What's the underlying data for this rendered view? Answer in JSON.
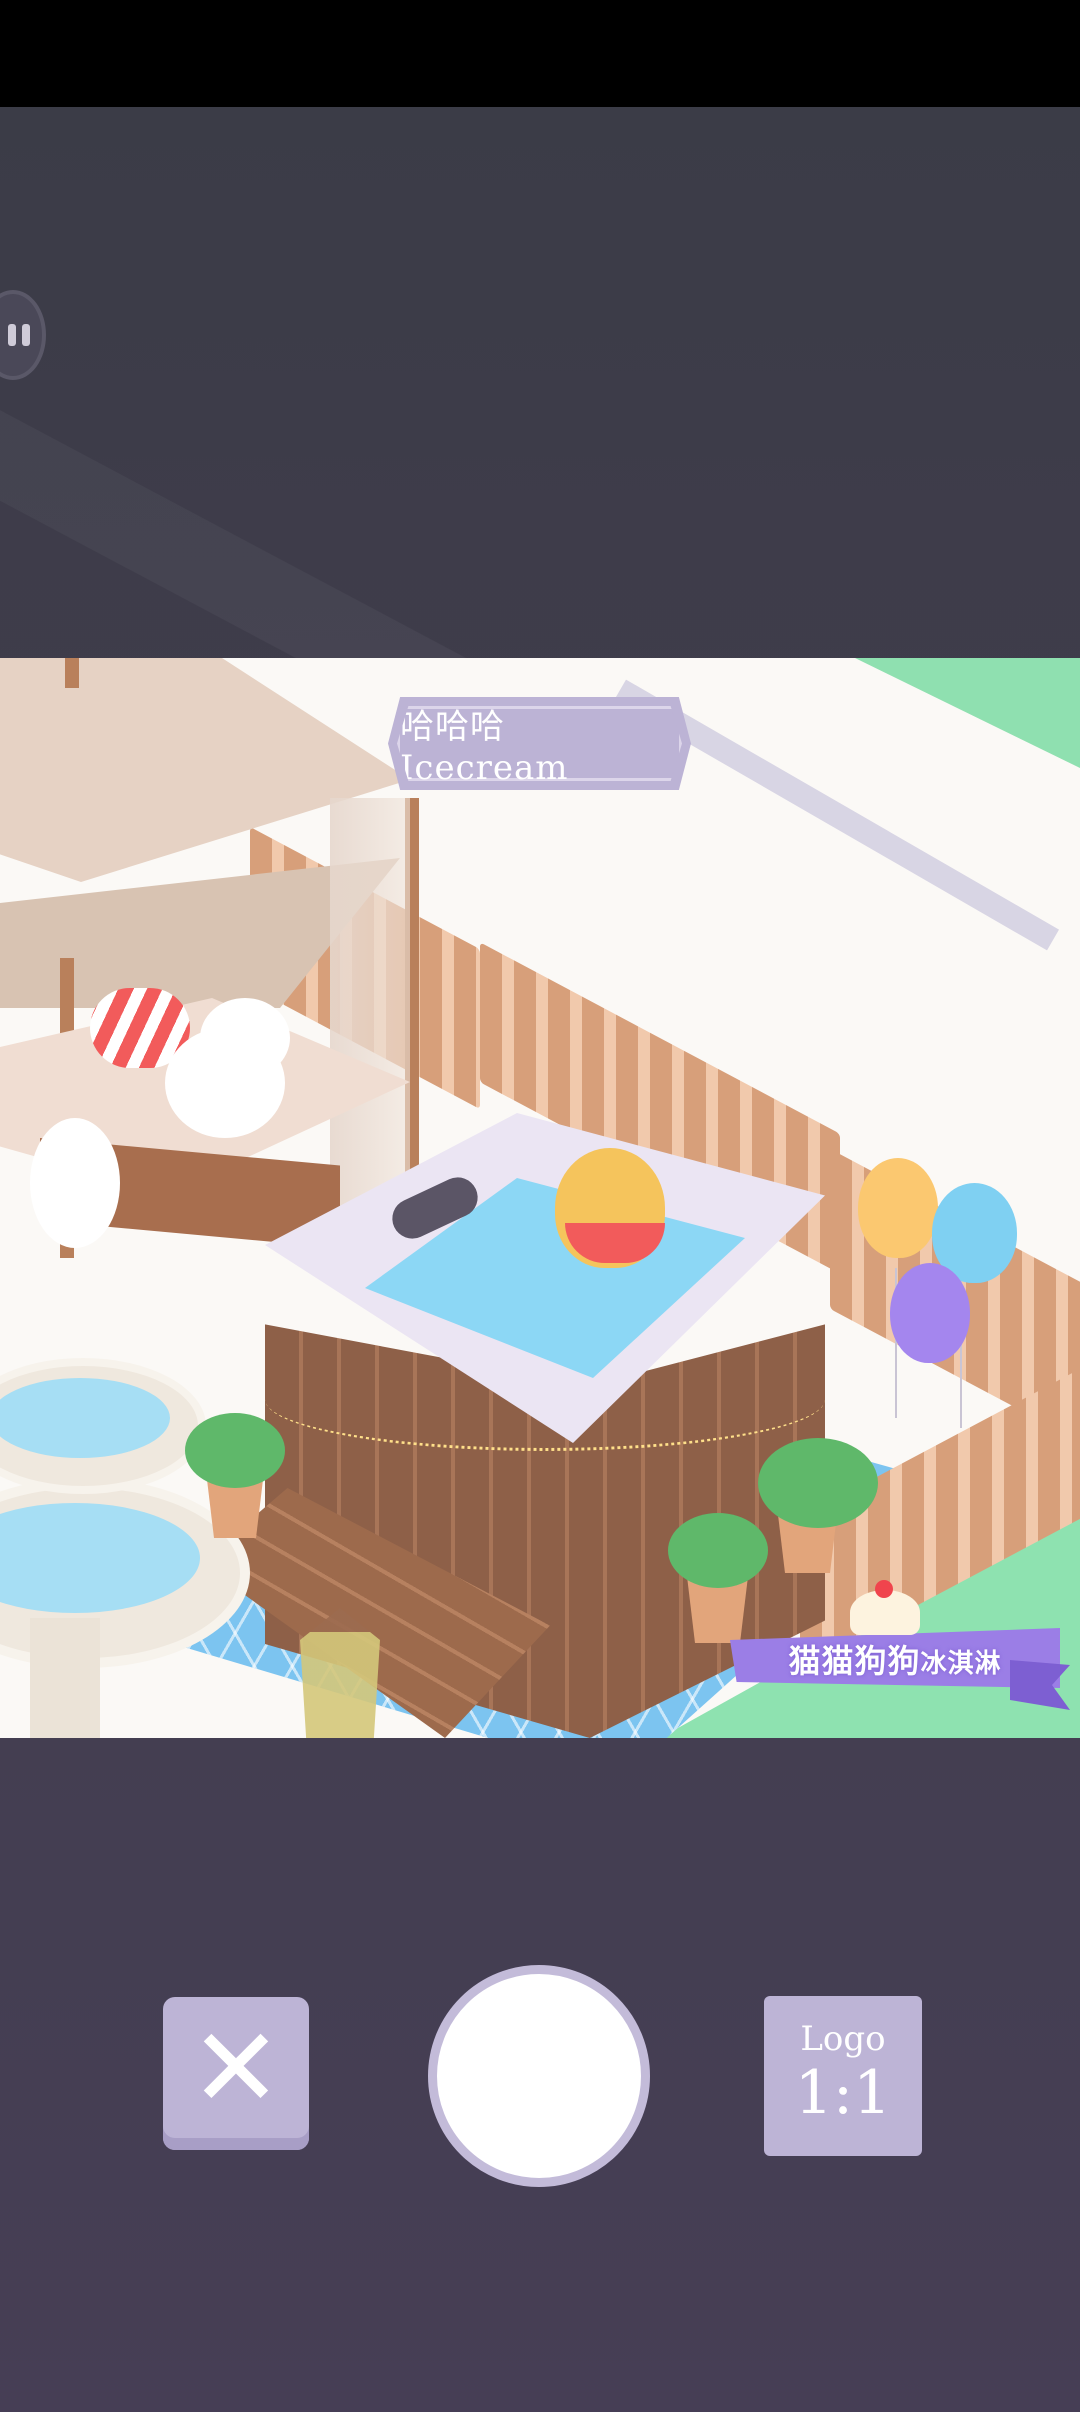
{
  "game": {
    "title": "哈哈哈 Icecream",
    "brand_text": "猫猫狗狗",
    "brand_text_small": "冰淇淋"
  },
  "controls": {
    "close_label": "✕",
    "logo_label_top": "Logo",
    "logo_label_ratio": "1:1"
  },
  "colors": {
    "overlay": "#3d3a4a",
    "button_bg": "#bdb4d6",
    "shutter_ring": "#c3bbd9",
    "grass": "#8ee2b0",
    "pool_tiles": "#7cc4f0",
    "brand_ribbon": "#9b7ee6"
  },
  "icons": [
    "pause-icon",
    "close-icon",
    "shutter-icon"
  ]
}
